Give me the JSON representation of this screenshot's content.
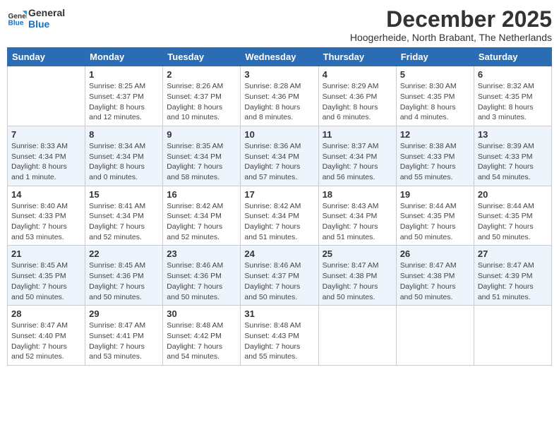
{
  "header": {
    "logo_line1": "General",
    "logo_line2": "Blue",
    "month_title": "December 2025",
    "location": "Hoogerheide, North Brabant, The Netherlands"
  },
  "weekdays": [
    "Sunday",
    "Monday",
    "Tuesday",
    "Wednesday",
    "Thursday",
    "Friday",
    "Saturday"
  ],
  "weeks": [
    [
      {
        "day": "",
        "info": ""
      },
      {
        "day": "1",
        "info": "Sunrise: 8:25 AM\nSunset: 4:37 PM\nDaylight: 8 hours\nand 12 minutes."
      },
      {
        "day": "2",
        "info": "Sunrise: 8:26 AM\nSunset: 4:37 PM\nDaylight: 8 hours\nand 10 minutes."
      },
      {
        "day": "3",
        "info": "Sunrise: 8:28 AM\nSunset: 4:36 PM\nDaylight: 8 hours\nand 8 minutes."
      },
      {
        "day": "4",
        "info": "Sunrise: 8:29 AM\nSunset: 4:36 PM\nDaylight: 8 hours\nand 6 minutes."
      },
      {
        "day": "5",
        "info": "Sunrise: 8:30 AM\nSunset: 4:35 PM\nDaylight: 8 hours\nand 4 minutes."
      },
      {
        "day": "6",
        "info": "Sunrise: 8:32 AM\nSunset: 4:35 PM\nDaylight: 8 hours\nand 3 minutes."
      }
    ],
    [
      {
        "day": "7",
        "info": "Sunrise: 8:33 AM\nSunset: 4:34 PM\nDaylight: 8 hours\nand 1 minute."
      },
      {
        "day": "8",
        "info": "Sunrise: 8:34 AM\nSunset: 4:34 PM\nDaylight: 8 hours\nand 0 minutes."
      },
      {
        "day": "9",
        "info": "Sunrise: 8:35 AM\nSunset: 4:34 PM\nDaylight: 7 hours\nand 58 minutes."
      },
      {
        "day": "10",
        "info": "Sunrise: 8:36 AM\nSunset: 4:34 PM\nDaylight: 7 hours\nand 57 minutes."
      },
      {
        "day": "11",
        "info": "Sunrise: 8:37 AM\nSunset: 4:34 PM\nDaylight: 7 hours\nand 56 minutes."
      },
      {
        "day": "12",
        "info": "Sunrise: 8:38 AM\nSunset: 4:33 PM\nDaylight: 7 hours\nand 55 minutes."
      },
      {
        "day": "13",
        "info": "Sunrise: 8:39 AM\nSunset: 4:33 PM\nDaylight: 7 hours\nand 54 minutes."
      }
    ],
    [
      {
        "day": "14",
        "info": "Sunrise: 8:40 AM\nSunset: 4:33 PM\nDaylight: 7 hours\nand 53 minutes."
      },
      {
        "day": "15",
        "info": "Sunrise: 8:41 AM\nSunset: 4:34 PM\nDaylight: 7 hours\nand 52 minutes."
      },
      {
        "day": "16",
        "info": "Sunrise: 8:42 AM\nSunset: 4:34 PM\nDaylight: 7 hours\nand 52 minutes."
      },
      {
        "day": "17",
        "info": "Sunrise: 8:42 AM\nSunset: 4:34 PM\nDaylight: 7 hours\nand 51 minutes."
      },
      {
        "day": "18",
        "info": "Sunrise: 8:43 AM\nSunset: 4:34 PM\nDaylight: 7 hours\nand 51 minutes."
      },
      {
        "day": "19",
        "info": "Sunrise: 8:44 AM\nSunset: 4:35 PM\nDaylight: 7 hours\nand 50 minutes."
      },
      {
        "day": "20",
        "info": "Sunrise: 8:44 AM\nSunset: 4:35 PM\nDaylight: 7 hours\nand 50 minutes."
      }
    ],
    [
      {
        "day": "21",
        "info": "Sunrise: 8:45 AM\nSunset: 4:35 PM\nDaylight: 7 hours\nand 50 minutes."
      },
      {
        "day": "22",
        "info": "Sunrise: 8:45 AM\nSunset: 4:36 PM\nDaylight: 7 hours\nand 50 minutes."
      },
      {
        "day": "23",
        "info": "Sunrise: 8:46 AM\nSunset: 4:36 PM\nDaylight: 7 hours\nand 50 minutes."
      },
      {
        "day": "24",
        "info": "Sunrise: 8:46 AM\nSunset: 4:37 PM\nDaylight: 7 hours\nand 50 minutes."
      },
      {
        "day": "25",
        "info": "Sunrise: 8:47 AM\nSunset: 4:38 PM\nDaylight: 7 hours\nand 50 minutes."
      },
      {
        "day": "26",
        "info": "Sunrise: 8:47 AM\nSunset: 4:38 PM\nDaylight: 7 hours\nand 50 minutes."
      },
      {
        "day": "27",
        "info": "Sunrise: 8:47 AM\nSunset: 4:39 PM\nDaylight: 7 hours\nand 51 minutes."
      }
    ],
    [
      {
        "day": "28",
        "info": "Sunrise: 8:47 AM\nSunset: 4:40 PM\nDaylight: 7 hours\nand 52 minutes."
      },
      {
        "day": "29",
        "info": "Sunrise: 8:47 AM\nSunset: 4:41 PM\nDaylight: 7 hours\nand 53 minutes."
      },
      {
        "day": "30",
        "info": "Sunrise: 8:48 AM\nSunset: 4:42 PM\nDaylight: 7 hours\nand 54 minutes."
      },
      {
        "day": "31",
        "info": "Sunrise: 8:48 AM\nSunset: 4:43 PM\nDaylight: 7 hours\nand 55 minutes."
      },
      {
        "day": "",
        "info": ""
      },
      {
        "day": "",
        "info": ""
      },
      {
        "day": "",
        "info": ""
      }
    ]
  ]
}
